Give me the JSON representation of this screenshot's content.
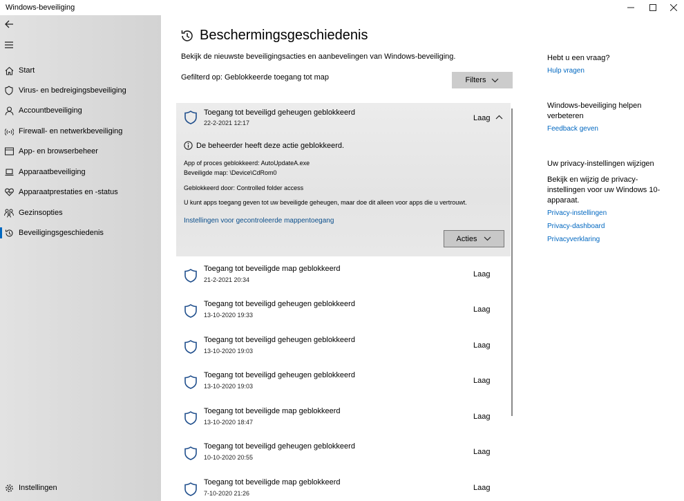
{
  "window": {
    "title": "Windows-beveiliging",
    "controls": [
      "minimize-icon",
      "maximize-icon",
      "close-icon"
    ]
  },
  "sidebar": {
    "items": [
      {
        "label": "Start",
        "icon": "home-icon"
      },
      {
        "label": "Virus- en bedreigingsbeveiliging",
        "icon": "shield-icon"
      },
      {
        "label": "Accountbeveiliging",
        "icon": "person-icon"
      },
      {
        "label": "Firewall- en netwerkbeveiliging",
        "icon": "wifi-icon"
      },
      {
        "label": "App- en browserbeheer",
        "icon": "browser-icon"
      },
      {
        "label": "Apparaatbeveiliging",
        "icon": "laptop-icon"
      },
      {
        "label": "Apparaatprestaties en -status",
        "icon": "heart-icon"
      },
      {
        "label": "Gezinsopties",
        "icon": "family-icon"
      },
      {
        "label": "Beveiligingsgeschiedenis",
        "icon": "history-icon",
        "active": true
      }
    ],
    "settings_label": "Instellingen"
  },
  "main": {
    "title": "Beschermingsgeschiedenis",
    "subtitle": "Bekijk de nieuwste beveiligingsacties en aanbevelingen van Windows-beveiliging.",
    "filter_text": "Gefilterd op: Geblokkeerde toegang tot map",
    "filters_button": "Filters",
    "expanded": {
      "title": "Toegang tot beveiligd geheugen geblokkeerd",
      "date": "22-2-2021 12:17",
      "level": "Laag",
      "admin_text": "De beheerder heeft deze actie geblokkeerd.",
      "app_line": "App of proces geblokkeerd: AutoUpdateA.exe",
      "map_line": "Beveiligde map: \\Device\\CdRom0",
      "blocked_by": "Geblokkeerd door: Controlled folder access",
      "advice": "U kunt apps toegang geven tot uw beveiligde geheugen, maar doe dit alleen voor apps die u vertrouwt.",
      "link": "Instellingen voor gecontroleerde mappentoegang",
      "acties_button": "Acties"
    },
    "items": [
      {
        "title": "Toegang tot beveiligde map geblokkeerd",
        "date": "21-2-2021 20:34",
        "level": "Laag"
      },
      {
        "title": "Toegang tot beveiligd geheugen geblokkeerd",
        "date": "13-10-2020 19:33",
        "level": "Laag"
      },
      {
        "title": "Toegang tot beveiligd geheugen geblokkeerd",
        "date": "13-10-2020 19:03",
        "level": "Laag"
      },
      {
        "title": "Toegang tot beveiligd geheugen geblokkeerd",
        "date": "13-10-2020 19:03",
        "level": "Laag"
      },
      {
        "title": "Toegang tot beveiligde map geblokkeerd",
        "date": "13-10-2020 18:47",
        "level": "Laag"
      },
      {
        "title": "Toegang tot beveiligd geheugen geblokkeerd",
        "date": "10-10-2020 20:55",
        "level": "Laag"
      },
      {
        "title": "Toegang tot beveiligde map geblokkeerd",
        "date": "7-10-2020 21:26",
        "level": "Laag"
      }
    ]
  },
  "right": {
    "question_heading": "Hebt u een vraag?",
    "help_link": "Hulp vragen",
    "improve_heading_1": "Windows-beveiliging helpen",
    "improve_heading_2": "verbeteren",
    "feedback_link": "Feedback geven",
    "privacy_heading": "Uw privacy-instellingen wijzigen",
    "privacy_text_1": "Bekijk en wijzig de privacy-",
    "privacy_text_2": "instellingen voor uw Windows 10-",
    "privacy_text_3": "apparaat.",
    "privacy_settings_link": "Privacy-instellingen",
    "privacy_dashboard_link": "Privacy-dashboard",
    "privacy_statement_link": "Privacyverklaring"
  },
  "colors": {
    "accent": "#0067c0",
    "shield_stroke": "#1f4e8c",
    "link_dark": "#0b4f8c"
  }
}
